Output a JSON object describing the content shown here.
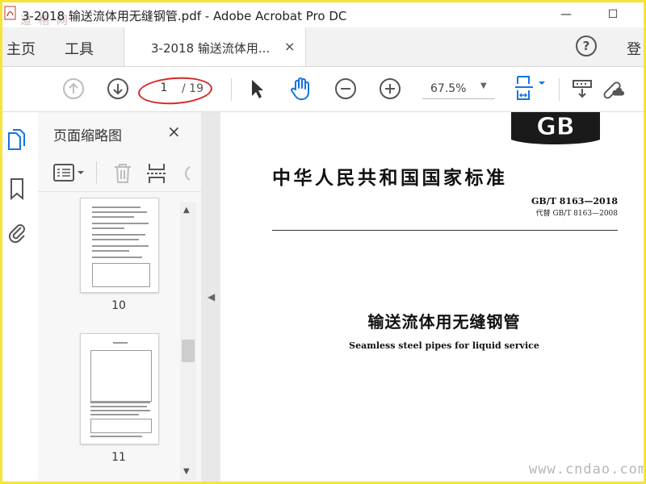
{
  "window": {
    "title": "3-2018 输送流体用无缝钢管.pdf - Adobe Acrobat Pro DC",
    "minimize": "—",
    "maximize": "☐",
    "watermark_top": "道 格 网"
  },
  "tabs": {
    "home": "主页",
    "tools": "工具",
    "document": "3-2018 输送流体用...",
    "close": "×",
    "login": "登"
  },
  "toolbar": {
    "page_current": "1",
    "page_total": "/ 19",
    "zoom": "67.5%"
  },
  "thumbnails_panel": {
    "title": "页面缩略图",
    "close": "×",
    "pages": [
      "10",
      "11"
    ]
  },
  "document": {
    "logo": "GB",
    "heading": "中华人民共和国国家标准",
    "standard_code": "GB/T 8163—2018",
    "replaces": "代替 GB/T 8163—2008",
    "title_cn": "输送流体用无缝钢管",
    "title_en": "Seamless steel pipes for liquid service"
  },
  "watermark": "www.cndao.com",
  "colors": {
    "accent_blue": "#1473e6",
    "frame_yellow": "#f7e33a",
    "annotation_red": "#d62828"
  }
}
